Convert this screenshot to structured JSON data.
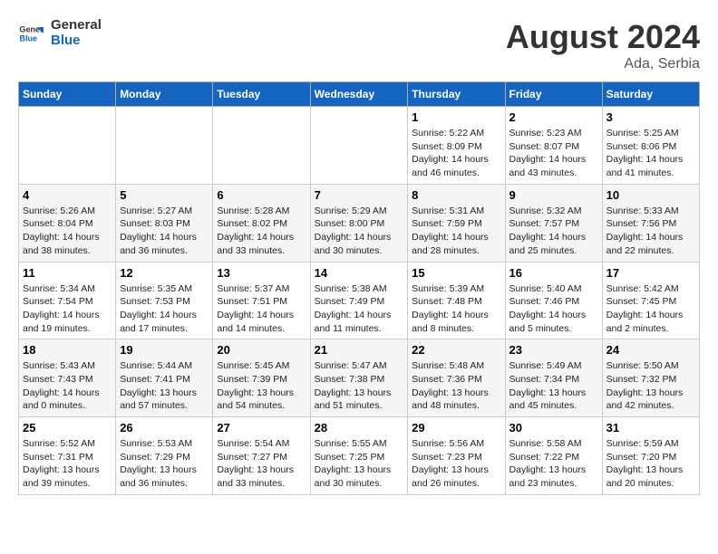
{
  "header": {
    "logo_general": "General",
    "logo_blue": "Blue",
    "title": "August 2024",
    "location": "Ada, Serbia"
  },
  "weekdays": [
    "Sunday",
    "Monday",
    "Tuesday",
    "Wednesday",
    "Thursday",
    "Friday",
    "Saturday"
  ],
  "weeks": [
    [
      {
        "day": "",
        "info": ""
      },
      {
        "day": "",
        "info": ""
      },
      {
        "day": "",
        "info": ""
      },
      {
        "day": "",
        "info": ""
      },
      {
        "day": "1",
        "info": "Sunrise: 5:22 AM\nSunset: 8:09 PM\nDaylight: 14 hours\nand 46 minutes."
      },
      {
        "day": "2",
        "info": "Sunrise: 5:23 AM\nSunset: 8:07 PM\nDaylight: 14 hours\nand 43 minutes."
      },
      {
        "day": "3",
        "info": "Sunrise: 5:25 AM\nSunset: 8:06 PM\nDaylight: 14 hours\nand 41 minutes."
      }
    ],
    [
      {
        "day": "4",
        "info": "Sunrise: 5:26 AM\nSunset: 8:04 PM\nDaylight: 14 hours\nand 38 minutes."
      },
      {
        "day": "5",
        "info": "Sunrise: 5:27 AM\nSunset: 8:03 PM\nDaylight: 14 hours\nand 36 minutes."
      },
      {
        "day": "6",
        "info": "Sunrise: 5:28 AM\nSunset: 8:02 PM\nDaylight: 14 hours\nand 33 minutes."
      },
      {
        "day": "7",
        "info": "Sunrise: 5:29 AM\nSunset: 8:00 PM\nDaylight: 14 hours\nand 30 minutes."
      },
      {
        "day": "8",
        "info": "Sunrise: 5:31 AM\nSunset: 7:59 PM\nDaylight: 14 hours\nand 28 minutes."
      },
      {
        "day": "9",
        "info": "Sunrise: 5:32 AM\nSunset: 7:57 PM\nDaylight: 14 hours\nand 25 minutes."
      },
      {
        "day": "10",
        "info": "Sunrise: 5:33 AM\nSunset: 7:56 PM\nDaylight: 14 hours\nand 22 minutes."
      }
    ],
    [
      {
        "day": "11",
        "info": "Sunrise: 5:34 AM\nSunset: 7:54 PM\nDaylight: 14 hours\nand 19 minutes."
      },
      {
        "day": "12",
        "info": "Sunrise: 5:35 AM\nSunset: 7:53 PM\nDaylight: 14 hours\nand 17 minutes."
      },
      {
        "day": "13",
        "info": "Sunrise: 5:37 AM\nSunset: 7:51 PM\nDaylight: 14 hours\nand 14 minutes."
      },
      {
        "day": "14",
        "info": "Sunrise: 5:38 AM\nSunset: 7:49 PM\nDaylight: 14 hours\nand 11 minutes."
      },
      {
        "day": "15",
        "info": "Sunrise: 5:39 AM\nSunset: 7:48 PM\nDaylight: 14 hours\nand 8 minutes."
      },
      {
        "day": "16",
        "info": "Sunrise: 5:40 AM\nSunset: 7:46 PM\nDaylight: 14 hours\nand 5 minutes."
      },
      {
        "day": "17",
        "info": "Sunrise: 5:42 AM\nSunset: 7:45 PM\nDaylight: 14 hours\nand 2 minutes."
      }
    ],
    [
      {
        "day": "18",
        "info": "Sunrise: 5:43 AM\nSunset: 7:43 PM\nDaylight: 14 hours\nand 0 minutes."
      },
      {
        "day": "19",
        "info": "Sunrise: 5:44 AM\nSunset: 7:41 PM\nDaylight: 13 hours\nand 57 minutes."
      },
      {
        "day": "20",
        "info": "Sunrise: 5:45 AM\nSunset: 7:39 PM\nDaylight: 13 hours\nand 54 minutes."
      },
      {
        "day": "21",
        "info": "Sunrise: 5:47 AM\nSunset: 7:38 PM\nDaylight: 13 hours\nand 51 minutes."
      },
      {
        "day": "22",
        "info": "Sunrise: 5:48 AM\nSunset: 7:36 PM\nDaylight: 13 hours\nand 48 minutes."
      },
      {
        "day": "23",
        "info": "Sunrise: 5:49 AM\nSunset: 7:34 PM\nDaylight: 13 hours\nand 45 minutes."
      },
      {
        "day": "24",
        "info": "Sunrise: 5:50 AM\nSunset: 7:32 PM\nDaylight: 13 hours\nand 42 minutes."
      }
    ],
    [
      {
        "day": "25",
        "info": "Sunrise: 5:52 AM\nSunset: 7:31 PM\nDaylight: 13 hours\nand 39 minutes."
      },
      {
        "day": "26",
        "info": "Sunrise: 5:53 AM\nSunset: 7:29 PM\nDaylight: 13 hours\nand 36 minutes."
      },
      {
        "day": "27",
        "info": "Sunrise: 5:54 AM\nSunset: 7:27 PM\nDaylight: 13 hours\nand 33 minutes."
      },
      {
        "day": "28",
        "info": "Sunrise: 5:55 AM\nSunset: 7:25 PM\nDaylight: 13 hours\nand 30 minutes."
      },
      {
        "day": "29",
        "info": "Sunrise: 5:56 AM\nSunset: 7:23 PM\nDaylight: 13 hours\nand 26 minutes."
      },
      {
        "day": "30",
        "info": "Sunrise: 5:58 AM\nSunset: 7:22 PM\nDaylight: 13 hours\nand 23 minutes."
      },
      {
        "day": "31",
        "info": "Sunrise: 5:59 AM\nSunset: 7:20 PM\nDaylight: 13 hours\nand 20 minutes."
      }
    ]
  ]
}
